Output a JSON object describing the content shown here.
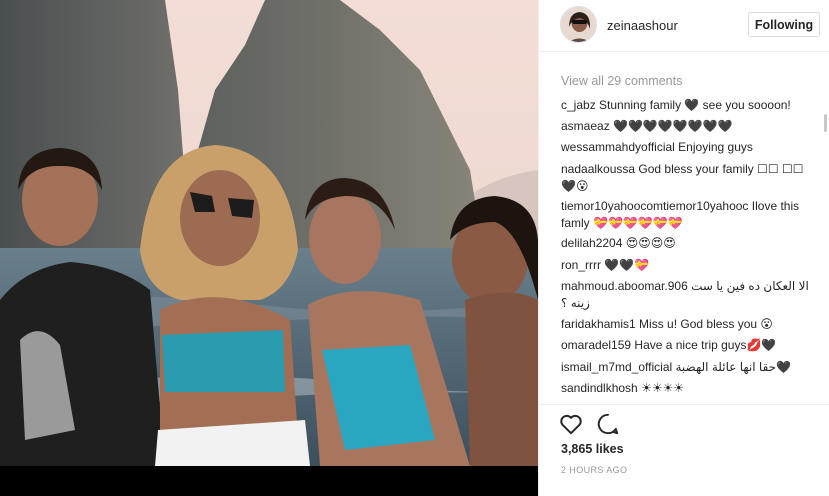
{
  "post": {
    "username": "zeinaashour",
    "follow_label": "Following",
    "view_all": "View all 29 comments",
    "comments": [
      {
        "user": "c_jabz",
        "text": "Stunning family 🖤 see you soooon!"
      },
      {
        "user": "asmaeaz",
        "text": "🖤🖤🖤🖤🖤🖤🖤🖤"
      },
      {
        "user": "wessammahdyofficial",
        "text": "Enjoying guys"
      },
      {
        "user": "nadaalkoussa",
        "text": "God bless your family ☐☐ ☐☐🖤😮"
      },
      {
        "user": "tiemor10yahoocomtiemor10yahooc",
        "text": "Ilove this famly 💝💝💝💝💝💝"
      },
      {
        "user": "delilah2204",
        "text": "😍😍😍😍"
      },
      {
        "user": "ron_rrrr",
        "text": "🖤🖤💝"
      },
      {
        "user": "mahmoud.aboomar.906",
        "text": "الا العكان ده فين يا ست زينه ؟"
      },
      {
        "user": "faridakhamis1",
        "text": "Miss u! God bless you 😮"
      },
      {
        "user": "omaradel159",
        "text": "Have a nice trip guys💋🖤"
      },
      {
        "user": "ismail_m7md_official",
        "text": "حقا انها عائلة الهضبة🖤"
      },
      {
        "user": "sandindlkhosh",
        "text": "☀☀☀☀"
      }
    ],
    "likes": "3,865 likes",
    "timestamp": "2 HOURS AGO"
  },
  "icons": {
    "like": "heart-outline-icon",
    "comment": "speech-bubble-icon"
  },
  "colors": {
    "border": "#efefef",
    "muted": "#999999",
    "text": "#262626"
  }
}
